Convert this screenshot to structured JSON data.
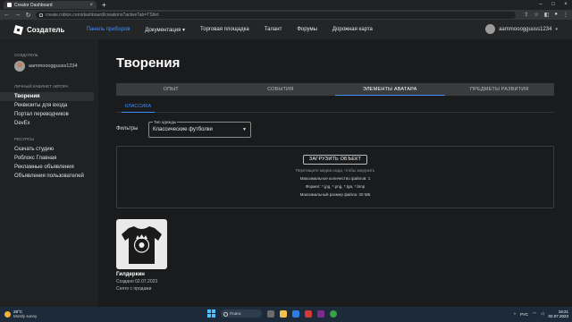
{
  "browser": {
    "tab_title": "Creator Dashboard",
    "url": "create.roblox.com/dashboard/creations?activeTab=TShirt",
    "colors": {
      "tabbar": "#202124",
      "toolbar": "#35363a"
    }
  },
  "topnav": {
    "brand": "Создатель",
    "links": [
      "Панель приборов",
      "Документация",
      "Торговая площадка",
      "Талант",
      "Форумы",
      "Дорожная карта"
    ],
    "active_link": "Панель приборов",
    "username": "aammooogguuss1234",
    "accent": "#3d8eff"
  },
  "sidebar": {
    "creator_label": "СОЗДАТЕЛЬ",
    "username": "aammooogguuss1234",
    "cabinet_label": "ЛИЧНЫЙ КАБИНЕТ АВТОРА",
    "cabinet_items": [
      "Творения",
      "Реквизиты для входа",
      "Портал переводчиков",
      "DevEx"
    ],
    "active_item": "Творения",
    "resources_label": "РЕСУРСЫ",
    "resource_items": [
      "Скачать студию",
      "Роблокс Главная",
      "Рекламные объявления",
      "Объявления пользователей"
    ]
  },
  "main": {
    "title": "Творения",
    "tabs": [
      "ОПЫТ",
      "СОБЫТИЯ",
      "ЭЛЕМЕНТЫ АВАТАРА",
      "ПРЕДМЕТЫ РАЗВИТИЯ"
    ],
    "active_tab": "ЭЛЕМЕНТЫ АВАТАРА",
    "subtab": "КЛАССИКА",
    "filter_label": "Фильтры",
    "select_legend": "Тип одежды",
    "select_value": "Классические футболки",
    "upload": {
      "button": "ЗАГРУЗИТЬ ОБЪЕКТ",
      "hint": "Перетащите медиа сюда, чтобы загрузить",
      "max_files": "Максимальное количество файлов: 1",
      "format": "Формат: *.jpg, *.png, *.tga, *.bmp",
      "max_size": "Максимальный размер файла: 20 МБ"
    },
    "item": {
      "name": "Гилдеркин",
      "created": "Создано 02.07.2023",
      "status": "Снято с продажи"
    }
  },
  "taskbar": {
    "temp": "28°C",
    "weather": "Mostly sunny",
    "search": "Поиск",
    "lang": "РУС",
    "time": "19:21",
    "date": "02.07.2023"
  }
}
